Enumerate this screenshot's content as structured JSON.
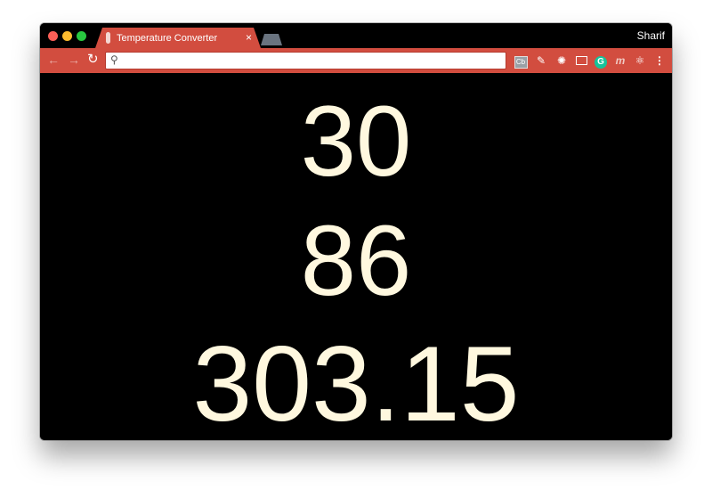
{
  "browser": {
    "tab_title": "Temperature Converter",
    "tab_close": "×",
    "user_name": "Sharif",
    "address_placeholder": "",
    "icons": {
      "back": "arrow-left-icon",
      "forward": "arrow-right-icon",
      "reload": "reload-icon",
      "search": "search-icon",
      "menu": "more-vertical-icon"
    },
    "extensions": [
      "cb-ext",
      "eyedropper-ext",
      "gear-ext",
      "cast-ext",
      "grammarly-ext",
      "m-ext",
      "react-ext"
    ],
    "ext_labels": {
      "cb": "Cb",
      "grammarly": "G",
      "m": "m"
    }
  },
  "temperatures": {
    "celsius": "30",
    "fahrenheit": "86",
    "kelvin": "303.15"
  },
  "colors": {
    "accent": "#d24d3f",
    "text": "#fff8df",
    "background": "#000000"
  }
}
